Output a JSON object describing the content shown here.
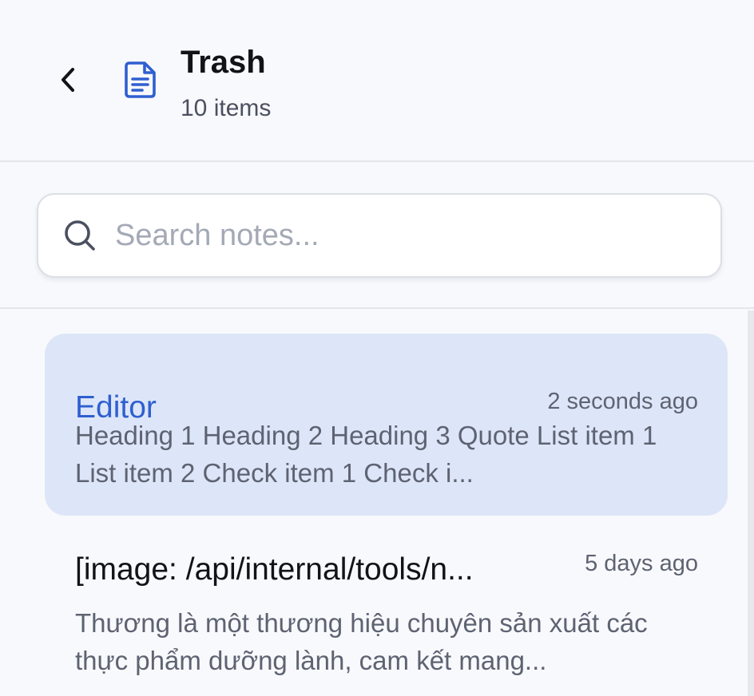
{
  "header": {
    "title": "Trash",
    "subtitle": "10 items",
    "back_icon": "chevron-left-icon",
    "folder_icon": "document-icon",
    "accent_color": "#2f5fd0"
  },
  "search": {
    "value": "",
    "placeholder": "Search notes...",
    "icon": "search-icon"
  },
  "notes": [
    {
      "title": "Editor",
      "time": "2 seconds ago",
      "preview": "Heading 1 Heading 2 Heading 3 Quote List item 1 List item 2 Check item 1 Check i...",
      "selected": true
    },
    {
      "title": "[image: /api/internal/tools/n...",
      "time": "5 days ago",
      "preview": "Thương là một thương hiệu chuyên sản xuất các thực phẩm dưỡng lành, cam kết mang...",
      "selected": false
    }
  ]
}
